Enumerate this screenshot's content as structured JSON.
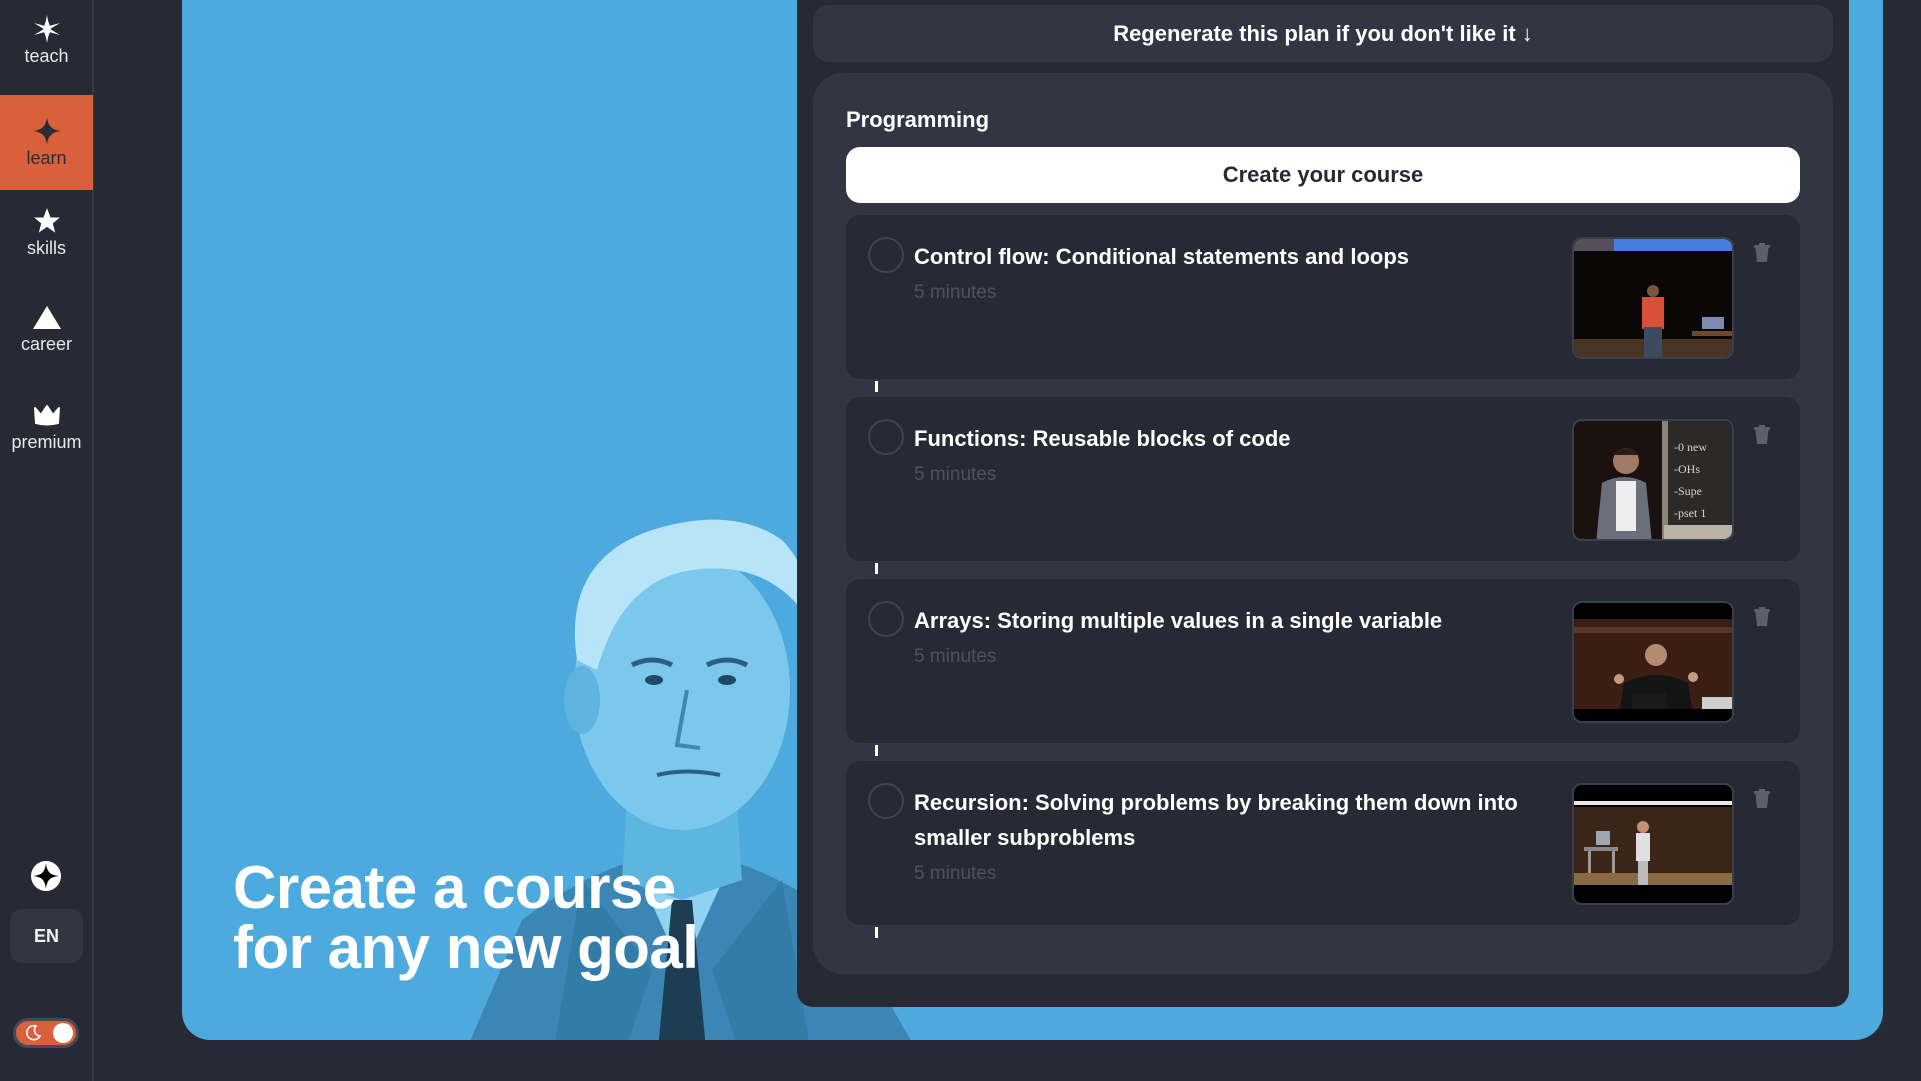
{
  "sidebar": {
    "items": [
      {
        "label": "teach",
        "icon": "sparkle-burst-icon",
        "active": false
      },
      {
        "label": "learn",
        "icon": "four-point-star-icon",
        "active": true
      },
      {
        "label": "skills",
        "icon": "star-icon",
        "active": false
      },
      {
        "label": "career",
        "icon": "triangle-icon",
        "active": false
      },
      {
        "label": "premium",
        "icon": "crown-icon",
        "active": false
      }
    ],
    "logo_icon": "logo-star-icon",
    "language": "EN",
    "theme_toggle": {
      "icon": "moon-icon",
      "state": "dark"
    }
  },
  "hero": {
    "heading_line1": "Create a course",
    "heading_line2": "for any new goal"
  },
  "plan": {
    "regenerate_label": "Regenerate this plan if you don't like it ↓",
    "topic": "Programming",
    "create_button": "Create your course",
    "lessons": [
      {
        "title": "Control flow: Conditional statements and loops",
        "duration": "5 minutes",
        "thumbnail": "lecture-stage-red-shirt"
      },
      {
        "title": "Functions: Reusable blocks of code",
        "duration": "5 minutes",
        "thumbnail": "lecture-chalkboard"
      },
      {
        "title": "Arrays: Storing multiple values in a single variable",
        "duration": "5 minutes",
        "thumbnail": "lecture-hall-gesturing"
      },
      {
        "title": "Recursion: Solving problems by breaking them down into smaller subproblems",
        "duration": "5 minutes",
        "thumbnail": "lecture-stage-wide"
      }
    ]
  },
  "colors": {
    "accent": "#d9603b",
    "frame_blue": "#4daade",
    "background": "#272a35",
    "panel": "#323642"
  }
}
